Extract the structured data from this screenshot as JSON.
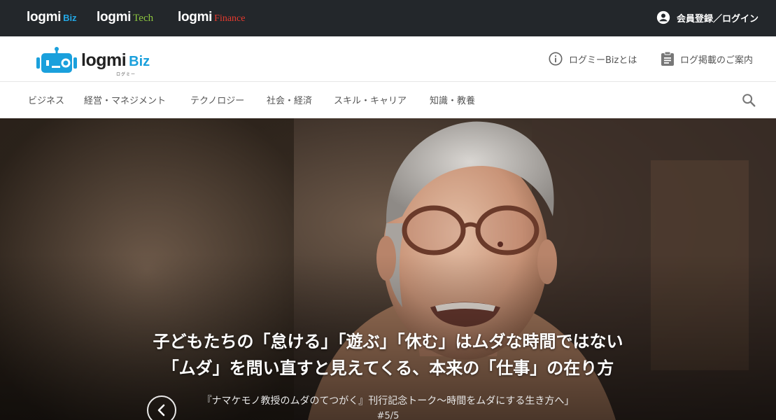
{
  "topbar": {
    "brands": [
      {
        "word": "logmi",
        "sub": "Biz"
      },
      {
        "word": "logmi",
        "sub": "Tech"
      },
      {
        "word": "logmi",
        "sub": "Finance"
      }
    ],
    "login_label": "会員登録／ログイン"
  },
  "header": {
    "logo_word": "logmi",
    "logo_sub": "Biz",
    "logo_kana": "ログミー",
    "links": [
      "ログミーBizとは",
      "ログ掲載のご案内"
    ]
  },
  "nav": {
    "items": [
      "ビジネス",
      "経営・マネジメント",
      "テクノロジー",
      "社会・経済",
      "スキル・キャリア",
      "知識・教養"
    ]
  },
  "hero": {
    "title_line1": "子どもたちの「怠ける」「遊ぶ」「休む」はムダな時間ではない",
    "title_line2": "「ムダ」を問い直すと見えてくる、本来の「仕事」の在り方",
    "subtitle": "『ナマケモノ教授のムダのてつがく』刊行記念トーク〜時間をムダにする生き方へ」",
    "counter": "#5/5"
  },
  "colors": {
    "topbar_bg": "#23272b",
    "biz_blue": "#23a8e6",
    "tech_green": "#8cc63f",
    "finance_red": "#e53a2e"
  },
  "icons": [
    "account-circle-icon",
    "info-icon",
    "clipboard-icon",
    "search-icon",
    "robot-logo-icon",
    "chevron-left-icon"
  ]
}
